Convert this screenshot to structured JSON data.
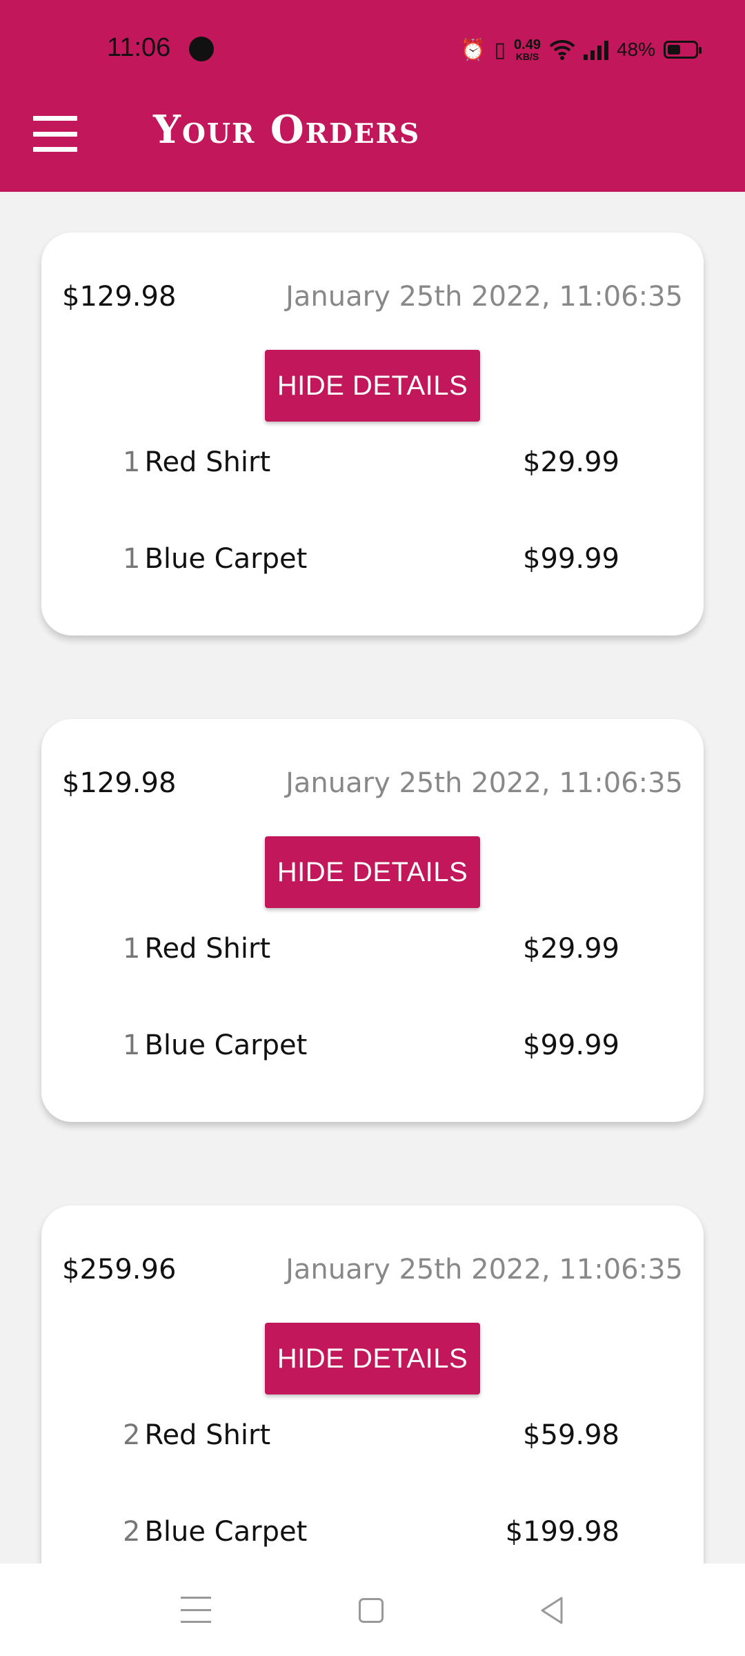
{
  "status_bar": {
    "time": "11:06",
    "speed_value": "0.49",
    "speed_unit": "KB/S",
    "battery": "48%"
  },
  "header": {
    "title": "Your Orders",
    "background_color": "#c2185b"
  },
  "orders": [
    {
      "total": "$129.98",
      "date": "January 25th 2022, 11:06:35",
      "toggle_label": "HIDE DETAILS",
      "items": [
        {
          "qty": "1",
          "title": "Red Shirt",
          "price": "$29.99"
        },
        {
          "qty": "1",
          "title": "Blue Carpet",
          "price": "$99.99"
        }
      ]
    },
    {
      "total": "$129.98",
      "date": "January 25th 2022, 11:06:35",
      "toggle_label": "HIDE DETAILS",
      "items": [
        {
          "qty": "1",
          "title": "Red Shirt",
          "price": "$29.99"
        },
        {
          "qty": "1",
          "title": "Blue Carpet",
          "price": "$99.99"
        }
      ]
    },
    {
      "total": "$259.96",
      "date": "January 25th 2022, 11:06:35",
      "toggle_label": "HIDE DETAILS",
      "items": [
        {
          "qty": "2",
          "title": "Red Shirt",
          "price": "$59.98"
        },
        {
          "qty": "2",
          "title": "Blue Carpet",
          "price": "$199.98"
        }
      ]
    }
  ]
}
